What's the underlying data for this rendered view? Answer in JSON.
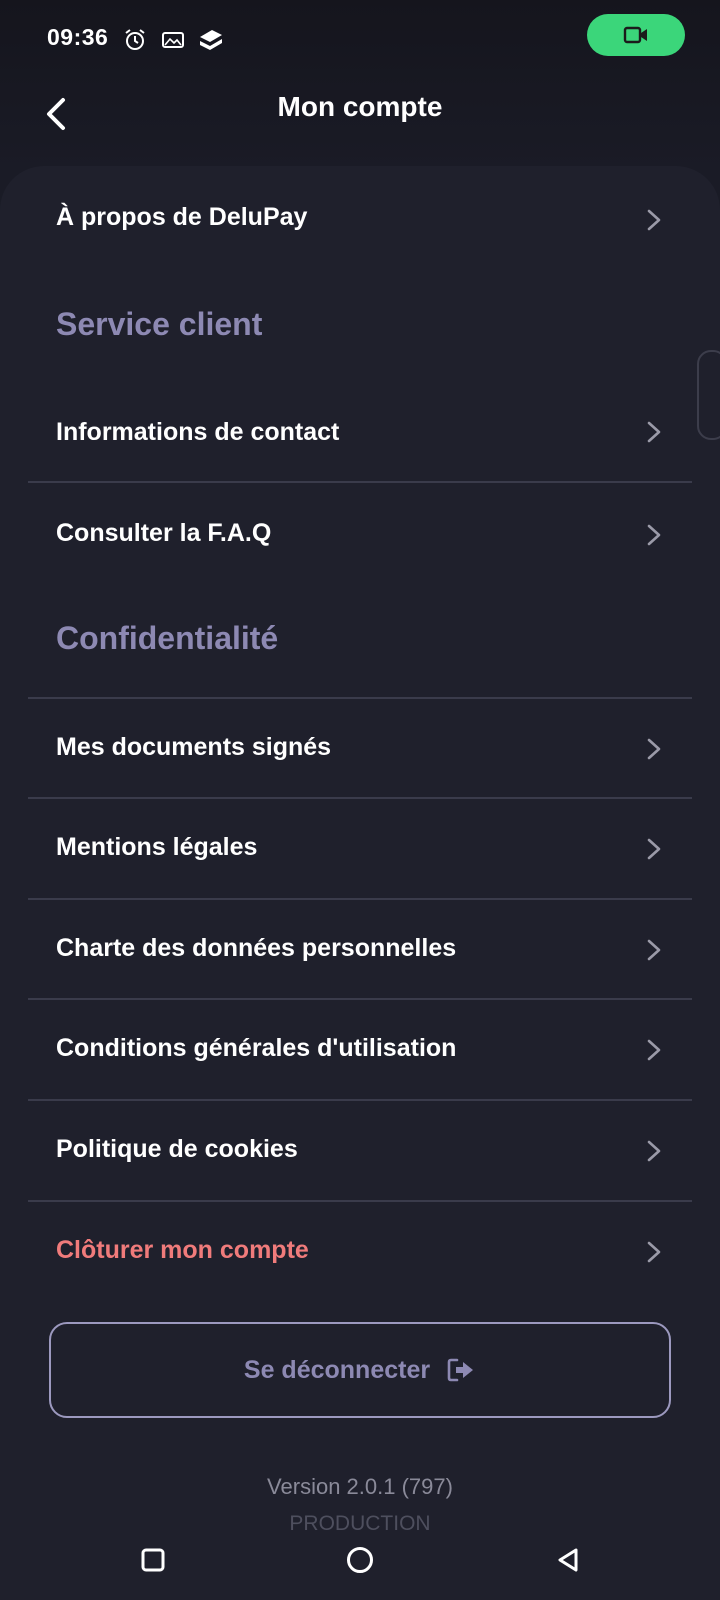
{
  "status_bar": {
    "time": "09:36",
    "icons": [
      "alarm-icon",
      "image-icon",
      "app-stack-icon"
    ],
    "camera_indicator_color": "#3bd67a"
  },
  "header": {
    "title": "Mon compte",
    "back_icon": "chevron-left-icon"
  },
  "menu": {
    "about": "À propos de DeluPay",
    "section_service": "Service client",
    "contact": "Informations de contact",
    "faq": "Consulter la F.A.Q",
    "section_privacy": "Confidentialité",
    "documents": "Mes documents signés",
    "legal": "Mentions légales",
    "data_charter": "Charte des données personnelles",
    "terms": "Conditions générales d'utilisation",
    "cookies": "Politique de cookies",
    "close_account": "Clôturer mon compte"
  },
  "logout": {
    "label": "Se déconnecter",
    "icon": "logout-icon"
  },
  "footer": {
    "version": "Version 2.0.1 (797)",
    "environment": "PRODUCTION"
  },
  "colors": {
    "background": "#1d1e2a",
    "section_title": "#8d89b3",
    "danger": "#f07b7b",
    "divider": "#3a3b4b"
  },
  "nav": {
    "icons": [
      "recent-apps-icon",
      "home-icon",
      "back-triangle-icon"
    ]
  }
}
